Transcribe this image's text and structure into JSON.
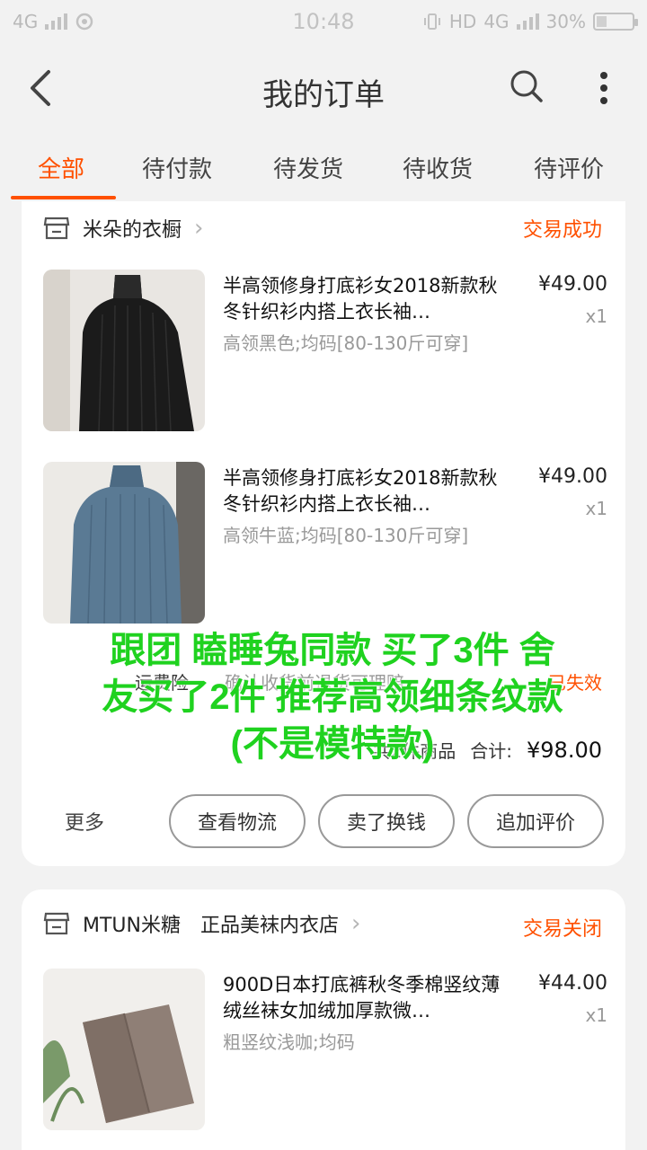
{
  "status_bar": {
    "left": "4G",
    "time": "10:48",
    "hd": "HD",
    "network": "4G",
    "battery": "30%",
    "battery_level": 0.3
  },
  "header": {
    "title": "我的订单"
  },
  "tabs": [
    {
      "label": "全部",
      "active": true
    },
    {
      "label": "待付款"
    },
    {
      "label": "待发货"
    },
    {
      "label": "待收货"
    },
    {
      "label": "待评价"
    }
  ],
  "orders": [
    {
      "shop": "米朵的衣橱",
      "status": "交易成功",
      "items": [
        {
          "title": "半高领修身打底衫女2018新款秋冬针织衫内搭上衣长袖…",
          "sku": "高领黑色;均码[80-130斤可穿]",
          "price": "¥49.00",
          "qty": "x1"
        },
        {
          "title": "半高领修身打底衫女2018新款秋冬针织衫内搭上衣长袖…",
          "sku": "高领牛蓝;均码[80-130斤可穿]",
          "price": "¥49.00",
          "qty": "x1"
        }
      ],
      "insurance": {
        "label": "运费险",
        "desc": "确认收货前退货可理赔",
        "status": "已失效"
      },
      "summary": {
        "count": "共2件商品",
        "total_label": "合计:",
        "total": "¥98.00"
      },
      "actions": {
        "more": "更多",
        "buttons": [
          "查看物流",
          "卖了换钱",
          "追加评价"
        ]
      }
    },
    {
      "shop": "MTUN米糖　正品美袜内衣店",
      "status": "交易关闭",
      "items": [
        {
          "title": "900D日本打底裤秋冬季棉竖纹薄绒丝袜女加绒加厚款微…",
          "sku": "粗竖纹浅咖;均码",
          "price": "¥44.00",
          "qty": "x1"
        }
      ]
    }
  ],
  "overlay_text": [
    "跟团 瞌睡兔同款 买了3件 舍",
    "友买了2件 推荐高领细条纹款",
    "(不是模特款)"
  ],
  "colors": {
    "accent": "#ff5000",
    "overlay": "#1fd21f"
  }
}
